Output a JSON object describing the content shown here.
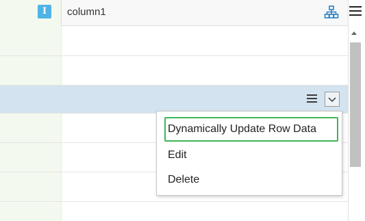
{
  "header": {
    "type_badge": "I",
    "column_title": "column1",
    "hierarchy_icon": "hierarchy-icon"
  },
  "grid_menu_icon": "hamburger-menu-icon",
  "row_actions": {
    "menu_icon": "hamburger-menu-icon",
    "dropdown_icon": "chevron-down-icon"
  },
  "context_menu": {
    "items": [
      {
        "label": "Dynamically Update Row Data",
        "highlighted": true
      },
      {
        "label": "Edit"
      },
      {
        "label": "Delete"
      }
    ],
    "highlight_color": "#3cb55a"
  },
  "colors": {
    "selected_row": "#d3e3ef",
    "left_column_bg": "#f3f9ee",
    "badge": "#4fb3e6"
  }
}
